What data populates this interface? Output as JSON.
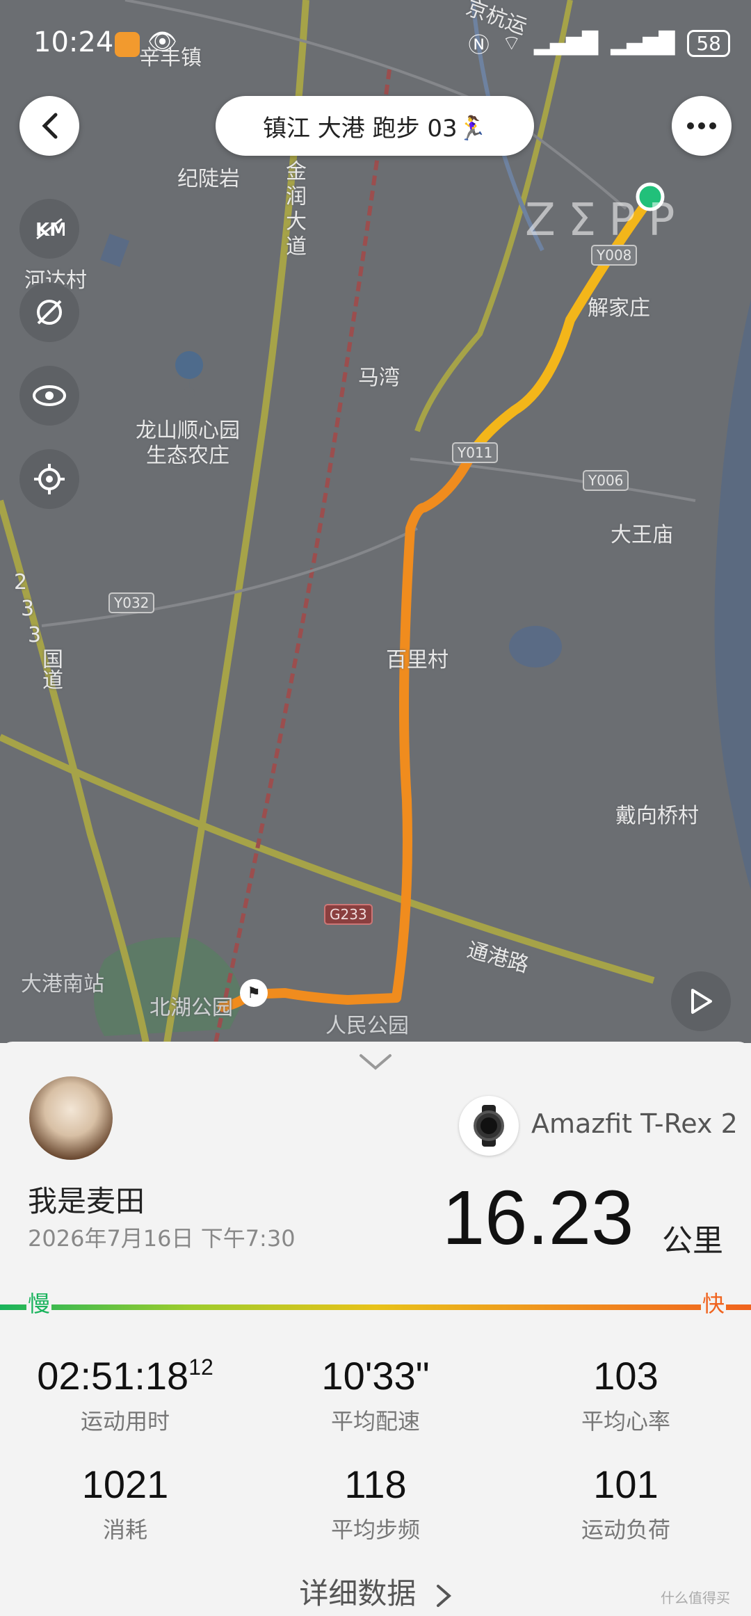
{
  "status_bar": {
    "time": "10:24",
    "battery": "58"
  },
  "header": {
    "title": "镇江 大港 跑步 03🏃‍♀️"
  },
  "map": {
    "watermark": "ZΣPP",
    "labels": [
      "辛丰镇",
      "纪陡岩",
      "金润大道",
      "河达村",
      "马湾",
      "龙山顺心园",
      "生态农庄",
      "解家庄",
      "大王庙",
      "2",
      "3",
      "3",
      "国道",
      "百里村",
      "戴向桥村",
      "大港南站",
      "北湖公园",
      "人民公园",
      "通港路",
      "京杭运"
    ],
    "road_tags": [
      "Y008",
      "Y011",
      "Y006",
      "Y032",
      "G233"
    ]
  },
  "panel": {
    "username": "我是麦田",
    "date": "2026年7月16日 下午7:30",
    "device": "Amazfit T-Rex 2",
    "distance": "16.23",
    "distance_unit": "公里",
    "slow_label": "慢",
    "fast_label": "快",
    "stats": [
      {
        "value": "02:51:18",
        "sup": "12",
        "label": "运动用时"
      },
      {
        "value": "10'33\"",
        "label": "平均配速"
      },
      {
        "value": "103",
        "label": "平均心率"
      },
      {
        "value": "1021",
        "label": "消耗"
      },
      {
        "value": "118",
        "label": "平均步频"
      },
      {
        "value": "101",
        "label": "运动负荷"
      }
    ],
    "details_label": "详细数据",
    "site_watermark": "什么值得买"
  },
  "colors": {
    "slow": "#19b35c",
    "fast": "#f0631e",
    "route_mid": "#f08c1e",
    "start": "#21c07a"
  }
}
